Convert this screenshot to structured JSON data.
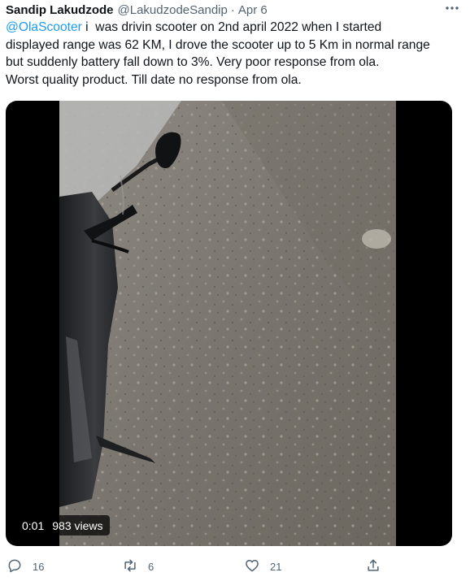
{
  "tweet": {
    "display_name": "Sandip Lakudzode",
    "handle": "@LakudzodeSandip",
    "separator": "·",
    "date": "Apr 6",
    "text": {
      "mention": "@OlaScooter",
      "line1_rest": " i  was drivin scooter on 2nd april 2022 when I started",
      "line2": "displayed range was 62 KM, I drove the scooter up to 5 Km in normal range",
      "line3": "but suddenly battery fall down to 3%. Very poor response from ola.",
      "line4": "Worst quality product. Till date no response from ola."
    }
  },
  "video": {
    "elapsed": "0:01",
    "views": "983 views"
  },
  "actions": {
    "replies": "16",
    "retweets": "6",
    "likes": "21"
  },
  "icons": {
    "more": "more-horizontal-icon",
    "reply": "reply-bubble-icon",
    "retweet": "retweet-icon",
    "like": "heart-icon",
    "share": "share-icon"
  },
  "colors": {
    "link": "#1d9bf0",
    "secondary_text": "#536471",
    "primary_text": "#0f1419"
  }
}
